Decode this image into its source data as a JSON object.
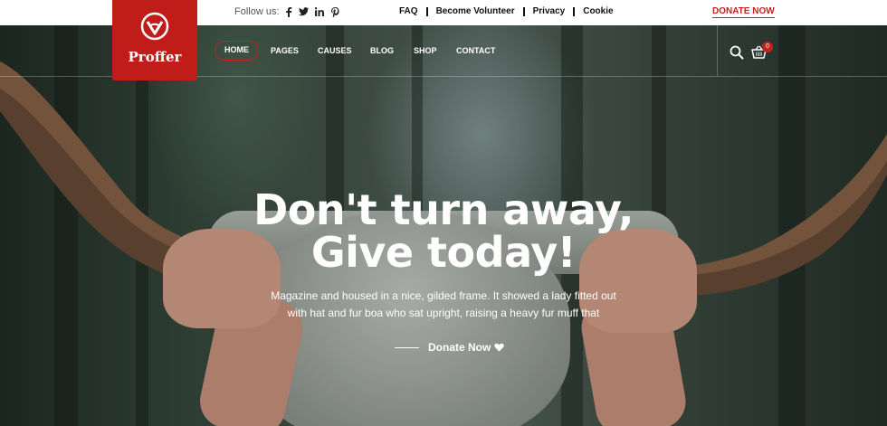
{
  "topbar": {
    "follow_label": "Follow us:",
    "social": [
      {
        "name": "facebook-icon",
        "glyph": "f"
      },
      {
        "name": "twitter-icon",
        "glyph": "t"
      },
      {
        "name": "linkedin-icon",
        "glyph": "in"
      },
      {
        "name": "pinterest-icon",
        "glyph": "p"
      }
    ],
    "links": [
      "FAQ",
      "Become Volunteer",
      "Privacy",
      "Cookie"
    ],
    "donate_label": "DONATE NOW"
  },
  "logo": {
    "text": "Proffer"
  },
  "nav": {
    "items": [
      "HOME",
      "PAGES",
      "CAUSES",
      "BLOG",
      "SHOP",
      "CONTACT"
    ],
    "active": "HOME"
  },
  "cart": {
    "count": "0"
  },
  "hero": {
    "line1": "Don't turn away,",
    "line2": "Give today!",
    "description": "Magazine and housed in a nice, gilded frame. It showed a lady fitted out with hat and fur boa who sat upright, raising a heavy fur muff that",
    "cta_label": "Donate Now"
  },
  "colors": {
    "accent": "#c6211d",
    "logo_bg": "#c01d1a",
    "text_light": "#ffffff"
  }
}
